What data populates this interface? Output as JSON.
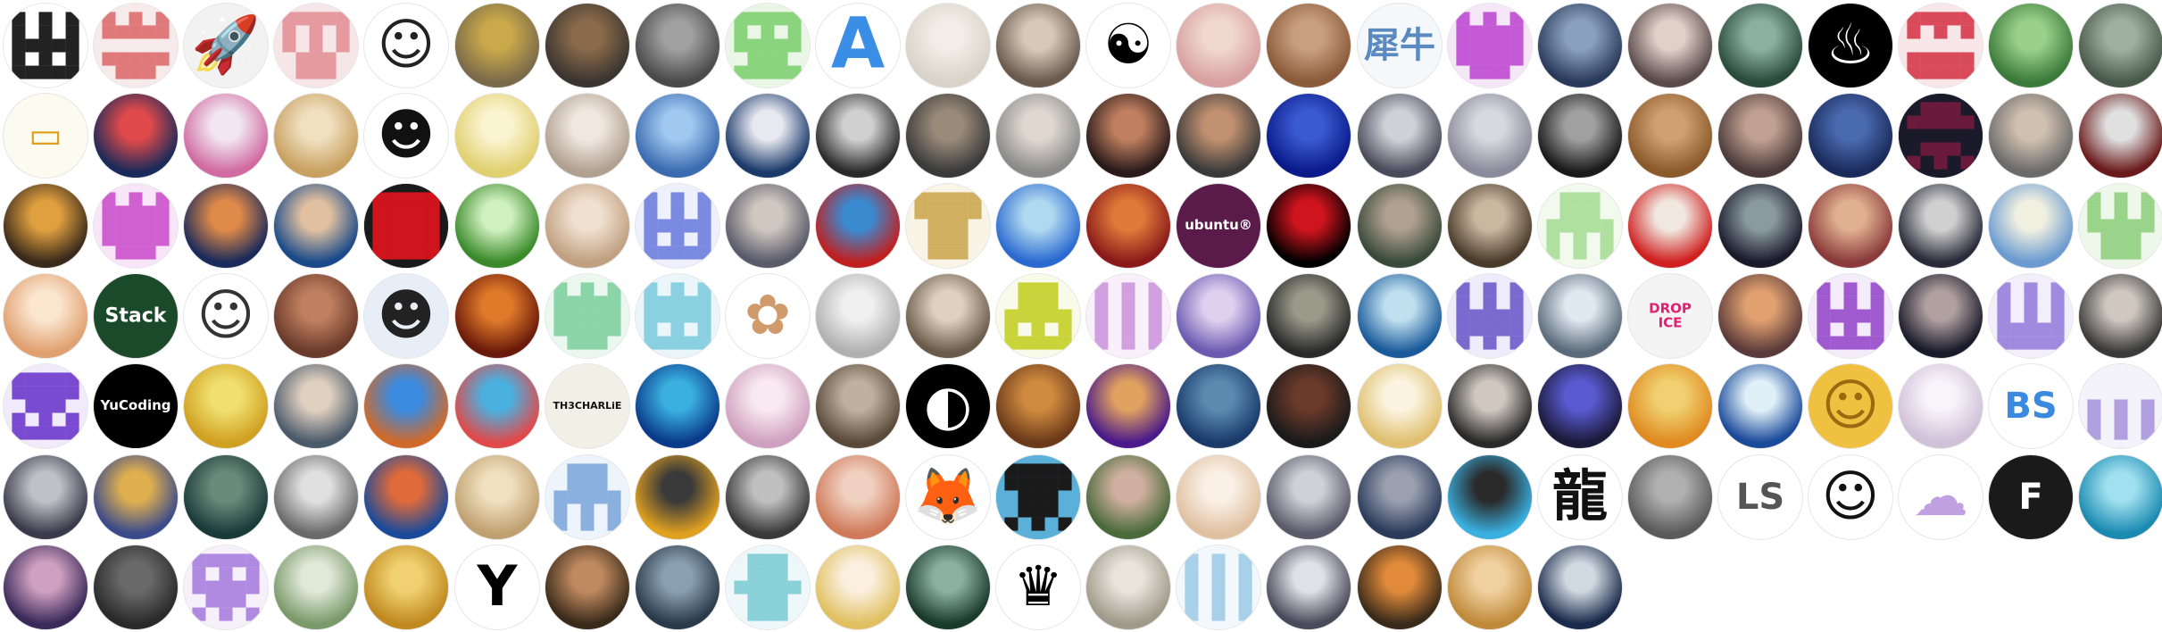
{
  "title": "",
  "avatars": [
    {
      "kind": "pixel",
      "color": "#222222",
      "bg": "#ffffff",
      "pattern": "1010111011"
    },
    {
      "kind": "pixel",
      "color": "#e07a7a",
      "bg": "#f6eaea",
      "pattern": "1011001101"
    },
    {
      "kind": "icon",
      "glyph": "🚀",
      "bg": "#f2f2f2",
      "icon": "rocket-icon"
    },
    {
      "kind": "pixel",
      "color": "#e59aa0",
      "bg": "#f7e6e8",
      "pattern": "1110100101"
    },
    {
      "kind": "icon",
      "glyph": "☺",
      "bg": "#ffffff",
      "fg": "#222222",
      "icon": "cartoon-face-icon"
    },
    {
      "kind": "photo",
      "c1": "#7a6a4a",
      "c2": "#c9a94a"
    },
    {
      "kind": "photo",
      "c1": "#3b3530",
      "c2": "#8a6a4a"
    },
    {
      "kind": "photo",
      "c1": "#4a4a4a",
      "c2": "#a0a0a0"
    },
    {
      "kind": "pixel",
      "color": "#8ad47e",
      "bg": "#eaf7e6",
      "pattern": "1110110111"
    },
    {
      "kind": "glyphicon",
      "glyph": "A",
      "bg": "#ffffff",
      "fg": "#3a8ee6",
      "icon": "letter-a-icon"
    },
    {
      "kind": "photo",
      "c1": "#d9d2c8",
      "c2": "#f2ede6"
    },
    {
      "kind": "photo",
      "c1": "#6a5a4e",
      "c2": "#d8c8b8"
    },
    {
      "kind": "icon",
      "glyph": "☯",
      "bg": "#ffffff",
      "fg": "#000000",
      "icon": "yin-yang-icon"
    },
    {
      "kind": "photo",
      "c1": "#d8a0a0",
      "c2": "#f0d8d0"
    },
    {
      "kind": "photo",
      "c1": "#8a5a3a",
      "c2": "#c8a080"
    },
    {
      "kind": "text",
      "text": "犀牛",
      "bg": "#f4f8fb",
      "fg": "#5a8abf"
    },
    {
      "kind": "pixel",
      "color": "#c45ad6",
      "bg": "#f5e6f8",
      "pattern": "1011111101"
    },
    {
      "kind": "photo",
      "c1": "#2a3a5a",
      "c2": "#8aa0c0"
    },
    {
      "kind": "photo",
      "c1": "#5a4a4a",
      "c2": "#e0d0c8"
    },
    {
      "kind": "photo",
      "c1": "#2a4a3a",
      "c2": "#8ab0a0"
    },
    {
      "kind": "icon",
      "glyph": "♨",
      "bg": "#000000",
      "fg": "#ffffff",
      "icon": "line-art-cat-icon"
    },
    {
      "kind": "pixel",
      "color": "#d94a5a",
      "bg": "#f8e6e8",
      "pattern": "1110001111"
    },
    {
      "kind": "photo",
      "c1": "#3a7a3a",
      "c2": "#9ad08a"
    },
    {
      "kind": "photo",
      "c1": "#4a5a4a",
      "c2": "#a0b0a0"
    },
    {
      "kind": "text",
      "text": "▭",
      "bg": "#fbfbf0",
      "fg": "#e0a020"
    },
    {
      "kind": "photo",
      "c1": "#1a2a5a",
      "c2": "#e04a4a"
    },
    {
      "kind": "photo",
      "c1": "#d06aa0",
      "c2": "#f2e6f2"
    },
    {
      "kind": "photo",
      "c1": "#c8a060",
      "c2": "#f0e0c0"
    },
    {
      "kind": "icon",
      "glyph": "☻",
      "bg": "#ffffff",
      "fg": "#111111",
      "icon": "cartoon-girl-icon"
    },
    {
      "kind": "photo",
      "c1": "#e0d070",
      "c2": "#fbf4d0"
    },
    {
      "kind": "photo",
      "c1": "#b0a090",
      "c2": "#f0e8e0"
    },
    {
      "kind": "photo",
      "c1": "#3a6ab0",
      "c2": "#a0c8f0"
    },
    {
      "kind": "photo",
      "c1": "#1a3a6a",
      "c2": "#e8e8f0"
    },
    {
      "kind": "photo",
      "c1": "#2a2a2a",
      "c2": "#d0d0d0"
    },
    {
      "kind": "photo",
      "c1": "#3a3a3a",
      "c2": "#9a8a7a"
    },
    {
      "kind": "photo",
      "c1": "#8a8a8a",
      "c2": "#e0d8d0"
    },
    {
      "kind": "photo",
      "c1": "#2a1a1a",
      "c2": "#c08060"
    },
    {
      "kind": "photo",
      "c1": "#3a3a3a",
      "c2": "#c09070"
    },
    {
      "kind": "photo",
      "c1": "#0a1a8a",
      "c2": "#3a5ad0"
    },
    {
      "kind": "photo",
      "c1": "#4a4a5a",
      "c2": "#d0d0d8"
    },
    {
      "kind": "photo",
      "c1": "#8a8a9a",
      "c2": "#d8d8e0"
    },
    {
      "kind": "photo",
      "c1": "#1a1a1a",
      "c2": "#a0a0a0"
    },
    {
      "kind": "photo",
      "c1": "#8a5a2a",
      "c2": "#d0a070"
    },
    {
      "kind": "photo",
      "c1": "#4a3a3a",
      "c2": "#c0a090"
    },
    {
      "kind": "photo",
      "c1": "#1a2a5a",
      "c2": "#4a6ab0"
    },
    {
      "kind": "pixel",
      "color": "#6a1a3a",
      "bg": "#1a1a2a",
      "pattern": "0111000110"
    },
    {
      "kind": "photo",
      "c1": "#6a6a6a",
      "c2": "#d0c0b0"
    },
    {
      "kind": "photo",
      "c1": "#6a1a1a",
      "c2": "#e0e0e0"
    },
    {
      "kind": "photo",
      "c1": "#3a2a1a",
      "c2": "#e0a040"
    },
    {
      "kind": "pixel",
      "color": "#d060d0",
      "bg": "#f8e6f8",
      "pattern": "1011111101"
    },
    {
      "kind": "photo",
      "c1": "#1a2a5a",
      "c2": "#e08a4a"
    },
    {
      "kind": "photo",
      "c1": "#1a4a8a",
      "c2": "#e0c0a0"
    },
    {
      "kind": "pixel",
      "color": "#d0141e",
      "bg": "#1a1a1a",
      "pattern": "1111111111"
    },
    {
      "kind": "photo",
      "c1": "#3a8a2a",
      "c2": "#d0f0c0"
    },
    {
      "kind": "photo",
      "c1": "#c0a080",
      "c2": "#f0e0d0"
    },
    {
      "kind": "pixel",
      "color": "#7a8ae0",
      "bg": "#eef0fb",
      "pattern": "1010111011"
    },
    {
      "kind": "photo",
      "c1": "#5a5a6a",
      "c2": "#d0c8c0"
    },
    {
      "kind": "photo",
      "c1": "#c02020",
      "c2": "#3a8ad0"
    },
    {
      "kind": "pixel",
      "color": "#d0b060",
      "bg": "#faf4e6",
      "pattern": "1111010101"
    },
    {
      "kind": "photo",
      "c1": "#2a6ad0",
      "c2": "#b0d8f0"
    },
    {
      "kind": "photo",
      "c1": "#8a1a1a",
      "c2": "#e07a3a"
    },
    {
      "kind": "text",
      "text": "ubuntu®",
      "bg": "#5a1a4a",
      "fg": "#ffffff"
    },
    {
      "kind": "photo",
      "c1": "#000000",
      "c2": "#d0141e"
    },
    {
      "kind": "photo",
      "c1": "#3a4a3a",
      "c2": "#b0a090"
    },
    {
      "kind": "photo",
      "c1": "#4a3a2a",
      "c2": "#c8b8a0"
    },
    {
      "kind": "pixel",
      "color": "#b0e0a0",
      "bg": "#f2faee",
      "pattern": "0101111010"
    },
    {
      "kind": "photo",
      "c1": "#d02020",
      "c2": "#f0e8e0"
    },
    {
      "kind": "photo",
      "c1": "#1a1a2a",
      "c2": "#8a9aa0"
    },
    {
      "kind": "photo",
      "c1": "#8a3a3a",
      "c2": "#e0b090"
    },
    {
      "kind": "photo",
      "c1": "#2a2a3a",
      "c2": "#d0d0d0"
    },
    {
      "kind": "photo",
      "c1": "#6a9ad0",
      "c2": "#f0f0e0"
    },
    {
      "kind": "pixel",
      "color": "#9ad48a",
      "bg": "#eef8ea",
      "pattern": "1010110101"
    },
    {
      "kind": "photo",
      "c1": "#e0a070",
      "c2": "#fbe6d0"
    },
    {
      "kind": "text",
      "text": "Stack",
      "bg": "#1a4a2a",
      "fg": "#ffffff"
    },
    {
      "kind": "icon",
      "glyph": "☺",
      "bg": "#ffffff",
      "fg": "#333333",
      "icon": "sketch-face-icon"
    },
    {
      "kind": "photo",
      "c1": "#6a3a2a",
      "c2": "#c08060"
    },
    {
      "kind": "icon",
      "glyph": "☻",
      "bg": "#e8eef8",
      "fg": "#222222",
      "icon": "headphone-girl-icon"
    },
    {
      "kind": "photo",
      "c1": "#6a1a0a",
      "c2": "#e07a2a"
    },
    {
      "kind": "pixel",
      "color": "#8ad4a8",
      "bg": "#ebf8f0",
      "pattern": "1011111101"
    },
    {
      "kind": "pixel",
      "color": "#8ad0e0",
      "bg": "#eaf6fa",
      "pattern": "1011111011"
    },
    {
      "kind": "icon",
      "glyph": "✿",
      "bg": "#ffffff",
      "fg": "#d09a6a",
      "icon": "sprout-doodle-icon"
    },
    {
      "kind": "photo",
      "c1": "#b0b0b0",
      "c2": "#f0f0f0"
    },
    {
      "kind": "photo",
      "c1": "#6a5a4a",
      "c2": "#e0d0c0"
    },
    {
      "kind": "pixel",
      "color": "#c8d43a",
      "bg": "#f8faea",
      "pattern": "0101111011"
    },
    {
      "kind": "pixel",
      "color": "#d0a0e0",
      "bg": "#faf0fb",
      "pattern": "1010101010"
    },
    {
      "kind": "photo",
      "c1": "#6a5ab0",
      "c2": "#e0d0f0"
    },
    {
      "kind": "photo",
      "c1": "#2a2a2a",
      "c2": "#9a9a8a"
    },
    {
      "kind": "photo",
      "c1": "#1a5a9a",
      "c2": "#c0e0f0"
    },
    {
      "kind": "pixel",
      "color": "#7a6ad0",
      "bg": "#eeecfa",
      "pattern": "1010111110"
    },
    {
      "kind": "photo",
      "c1": "#5a6a7a",
      "c2": "#e0e8f0"
    },
    {
      "kind": "text",
      "text": "DROP\nICE",
      "bg": "#f4f4f4",
      "fg": "#e02070"
    },
    {
      "kind": "photo",
      "c1": "#5a3a3a",
      "c2": "#e0a070"
    },
    {
      "kind": "pixel",
      "color": "#a05ad0",
      "bg": "#f4ecfa",
      "pattern": "1010111011"
    },
    {
      "kind": "photo",
      "c1": "#1a1a2a",
      "c2": "#b0a0a0"
    },
    {
      "kind": "pixel",
      "color": "#a08ae0",
      "bg": "#f2eefb",
      "pattern": "1010101111"
    },
    {
      "kind": "photo",
      "c1": "#3a3a3a",
      "c2": "#d0c8c0"
    },
    {
      "kind": "pixel",
      "color": "#7a4ad0",
      "bg": "#f0eafb",
      "pattern": "1111011011"
    },
    {
      "kind": "text",
      "text": "YuCoding",
      "bg": "#000000",
      "fg": "#ffffff"
    },
    {
      "kind": "photo",
      "c1": "#d0a020",
      "c2": "#f0e070"
    },
    {
      "kind": "photo",
      "c1": "#4a5a6a",
      "c2": "#e0d0c0"
    },
    {
      "kind": "photo",
      "c1": "#d06a2a",
      "c2": "#3a8ae0"
    },
    {
      "kind": "photo",
      "c1": "#e04a4a",
      "c2": "#4ab0e0"
    },
    {
      "kind": "text",
      "text": "TH3CHARLiE",
      "bg": "#f2f0e6",
      "fg": "#111111"
    },
    {
      "kind": "photo",
      "c1": "#0a3a8a",
      "c2": "#3ab0e0"
    },
    {
      "kind": "photo",
      "c1": "#d0a0c0",
      "c2": "#f8eaf0"
    },
    {
      "kind": "photo",
      "c1": "#5a4a3a",
      "c2": "#c0b0a0"
    },
    {
      "kind": "icon",
      "glyph": "◐",
      "bg": "#000000",
      "fg": "#ffffff",
      "icon": "abstract-swoosh-icon"
    },
    {
      "kind": "photo",
      "c1": "#6a3a1a",
      "c2": "#d08a40"
    },
    {
      "kind": "photo",
      "c1": "#4a1a8a",
      "c2": "#e0a060"
    },
    {
      "kind": "photo",
      "c1": "#1a3a6a",
      "c2": "#5a8ab0"
    },
    {
      "kind": "photo",
      "c1": "#1a1a1a",
      "c2": "#6a3a2a"
    },
    {
      "kind": "photo",
      "c1": "#e0c070",
      "c2": "#fbf4e0"
    },
    {
      "kind": "photo",
      "c1": "#2a2a2a",
      "c2": "#d0c8c0"
    },
    {
      "kind": "photo",
      "c1": "#1a1a3a",
      "c2": "#5a5ad0"
    },
    {
      "kind": "photo",
      "c1": "#e08a20",
      "c2": "#f0d070"
    },
    {
      "kind": "photo",
      "c1": "#1a4a9a",
      "c2": "#e0f0f8"
    },
    {
      "kind": "icon",
      "glyph": "☺",
      "bg": "#f0c040",
      "fg": "#9a6a10",
      "icon": "thinking-emoji-icon"
    },
    {
      "kind": "photo",
      "c1": "#d0c0d8",
      "c2": "#f8f4fa"
    },
    {
      "kind": "text",
      "text": "BS",
      "bg": "#ffffff",
      "fg": "#3a8ae0"
    },
    {
      "kind": "pixel",
      "color": "#b0a0e0",
      "bg": "#f4f2fb",
      "pattern": "0000101010"
    },
    {
      "kind": "photo",
      "c1": "#3a3a4a",
      "c2": "#c0c0c8"
    },
    {
      "kind": "photo",
      "c1": "#3a4a8a",
      "c2": "#e0b050"
    },
    {
      "kind": "photo",
      "c1": "#1a3a3a",
      "c2": "#6a8a7a"
    },
    {
      "kind": "photo",
      "c1": "#6a6a6a",
      "c2": "#e0e0e0"
    },
    {
      "kind": "photo",
      "c1": "#1a4a9a",
      "c2": "#e06a3a"
    },
    {
      "kind": "photo",
      "c1": "#c0a070",
      "c2": "#f0e0c0"
    },
    {
      "kind": "pixel",
      "color": "#8ab0e0",
      "bg": "#eef4fb",
      "pattern": "0101111010"
    },
    {
      "kind": "photo",
      "c1": "#e0a020",
      "c2": "#3a3a3a"
    },
    {
      "kind": "photo",
      "c1": "#3a3a3a",
      "c2": "#c0c0c0"
    },
    {
      "kind": "photo",
      "c1": "#d07a5a",
      "c2": "#f0d0c0"
    },
    {
      "kind": "icon",
      "glyph": "🦊",
      "bg": "#ffffff",
      "fg": "#e08a2a",
      "icon": "fox-icon"
    },
    {
      "kind": "pixel",
      "color": "#1a1a1a",
      "bg": "#5ab0d8",
      "pattern": "1111010110"
    },
    {
      "kind": "photo",
      "c1": "#4a6a3a",
      "c2": "#d0b0a0"
    },
    {
      "kind": "photo",
      "c1": "#e0c0a0",
      "c2": "#faf0e6"
    },
    {
      "kind": "photo",
      "c1": "#5a5a6a",
      "c2": "#d0d0d8"
    },
    {
      "kind": "photo",
      "c1": "#2a3a5a",
      "c2": "#9aa0b0"
    },
    {
      "kind": "photo",
      "c1": "#3ab0e0",
      "c2": "#2a2a2a"
    },
    {
      "kind": "icon",
      "glyph": "龍",
      "bg": "#ffffff",
      "fg": "#111111",
      "icon": "dragon-calligraphy-icon"
    },
    {
      "kind": "photo",
      "c1": "#5a5a5a",
      "c2": "#b0b0b0"
    },
    {
      "kind": "text",
      "text": "LS",
      "bg": "#ffffff",
      "fg": "#555555"
    },
    {
      "kind": "icon",
      "glyph": "☺",
      "bg": "#ffffff",
      "fg": "#111111",
      "icon": "glasses-face-icon"
    },
    {
      "kind": "icon",
      "glyph": "☁",
      "bg": "#ffffff",
      "fg": "#c0a0e0",
      "icon": "panda-doodle-icon"
    },
    {
      "kind": "text",
      "text": "F",
      "bg": "#1a1a1a",
      "fg": "#ffffff"
    },
    {
      "kind": "photo",
      "c1": "#1a8ab0",
      "c2": "#a0e0f0"
    },
    {
      "kind": "photo",
      "c1": "#3a2a5a",
      "c2": "#d0a0c0"
    },
    {
      "kind": "photo",
      "c1": "#2a2a2a",
      "c2": "#6a6a6a"
    },
    {
      "kind": "pixel",
      "color": "#b08ae0",
      "bg": "#f6f0fb",
      "pattern": "1110110110"
    },
    {
      "kind": "photo",
      "c1": "#7a9a6a",
      "c2": "#e0e8d8"
    },
    {
      "kind": "photo",
      "c1": "#c08a20",
      "c2": "#f0d070"
    },
    {
      "kind": "icon",
      "glyph": "Y",
      "bg": "#ffffff",
      "fg": "#000000",
      "icon": "y-logo-icon"
    },
    {
      "kind": "photo",
      "c1": "#3a2a1a",
      "c2": "#c08a60"
    },
    {
      "kind": "photo",
      "c1": "#2a3a4a",
      "c2": "#8aa0b0"
    },
    {
      "kind": "pixel",
      "color": "#8ad0d8",
      "bg": "#eef8fa",
      "pattern": "0101110101"
    },
    {
      "kind": "photo",
      "c1": "#e0c060",
      "c2": "#fbf0e0"
    },
    {
      "kind": "photo",
      "c1": "#1a3a2a",
      "c2": "#8ab0a0"
    },
    {
      "kind": "icon",
      "glyph": "♛",
      "bg": "#ffffff",
      "fg": "#000000",
      "icon": "crown-icon"
    },
    {
      "kind": "photo",
      "c1": "#a09a8a",
      "c2": "#e8e4dc"
    },
    {
      "kind": "pixel",
      "color": "#a8d0e8",
      "bg": "#f2f8fb",
      "pattern": "1010101010"
    },
    {
      "kind": "photo",
      "c1": "#4a4a5a",
      "c2": "#e0e0e8"
    },
    {
      "kind": "photo",
      "c1": "#3a2a1a",
      "c2": "#e08a3a"
    },
    {
      "kind": "photo",
      "c1": "#c08a3a",
      "c2": "#f0d0a0"
    },
    {
      "kind": "photo",
      "c1": "#1a2a4a",
      "c2": "#d0d8e0"
    }
  ]
}
